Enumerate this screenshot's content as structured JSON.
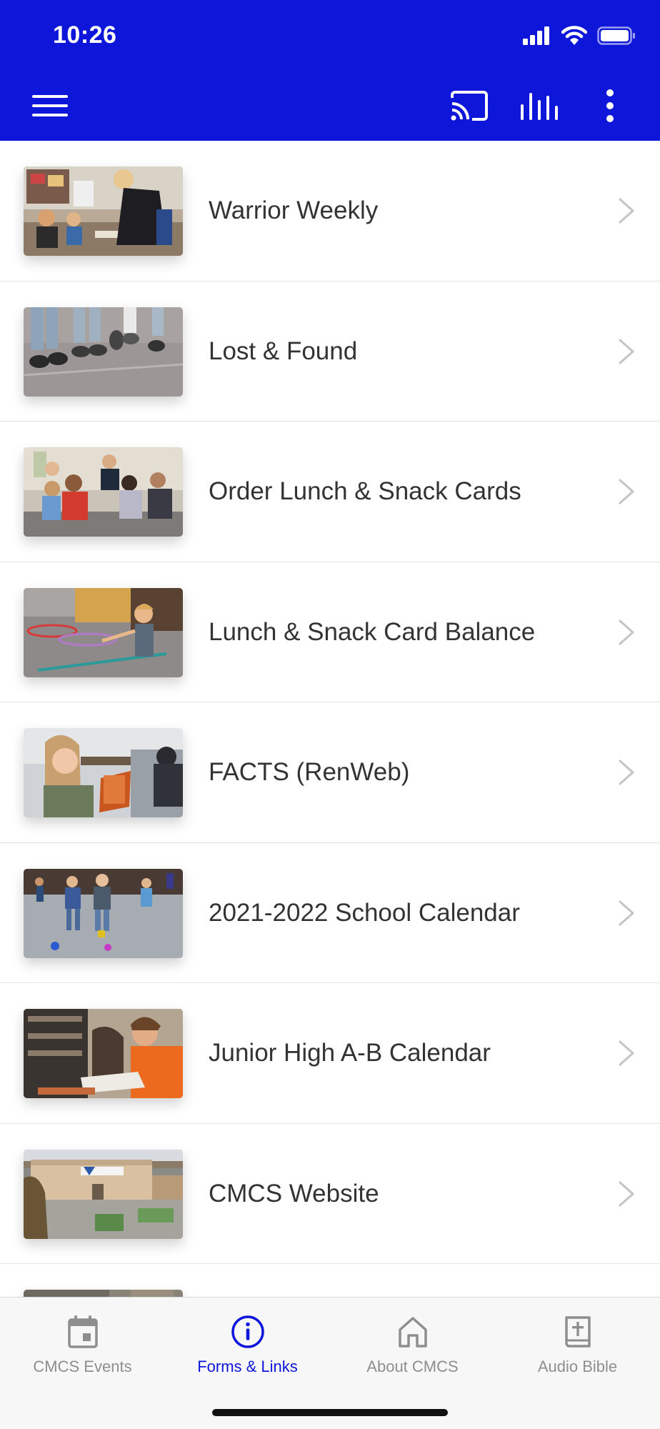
{
  "status_bar": {
    "time": "10:26"
  },
  "colors": {
    "brand": "#0d16d9",
    "text": "#333333",
    "tab_inactive": "#8e8e8e",
    "divider": "#e4e4e4"
  },
  "header": {
    "icons": [
      "menu-icon",
      "cast-icon",
      "stats-icon",
      "more-vertical-icon"
    ]
  },
  "list": {
    "items": [
      {
        "label": "Warrior Weekly",
        "thumbnail": "classroom-photo"
      },
      {
        "label": "Lost & Found",
        "thumbnail": "sneakers-photo"
      },
      {
        "label": "Order Lunch & Snack Cards",
        "thumbnail": "students-table-photo"
      },
      {
        "label": "Lunch & Snack Card Balance",
        "thumbnail": "hula-hoop-photo"
      },
      {
        "label": "FACTS (RenWeb)",
        "thumbnail": "student-reading-photo"
      },
      {
        "label": "2021-2022 School Calendar",
        "thumbnail": "playground-photo"
      },
      {
        "label": "Junior High A-B Calendar",
        "thumbnail": "student-book-photo"
      },
      {
        "label": "CMCS Website",
        "thumbnail": "school-building-photo"
      },
      {
        "label": "",
        "thumbnail": "partial-photo"
      }
    ]
  },
  "tabs": [
    {
      "label": "CMCS Events",
      "icon": "calendar-icon",
      "active": false
    },
    {
      "label": "Forms & Links",
      "icon": "info-icon",
      "active": true
    },
    {
      "label": "About CMCS",
      "icon": "home-icon",
      "active": false
    },
    {
      "label": "Audio Bible",
      "icon": "bible-icon",
      "active": false
    }
  ]
}
